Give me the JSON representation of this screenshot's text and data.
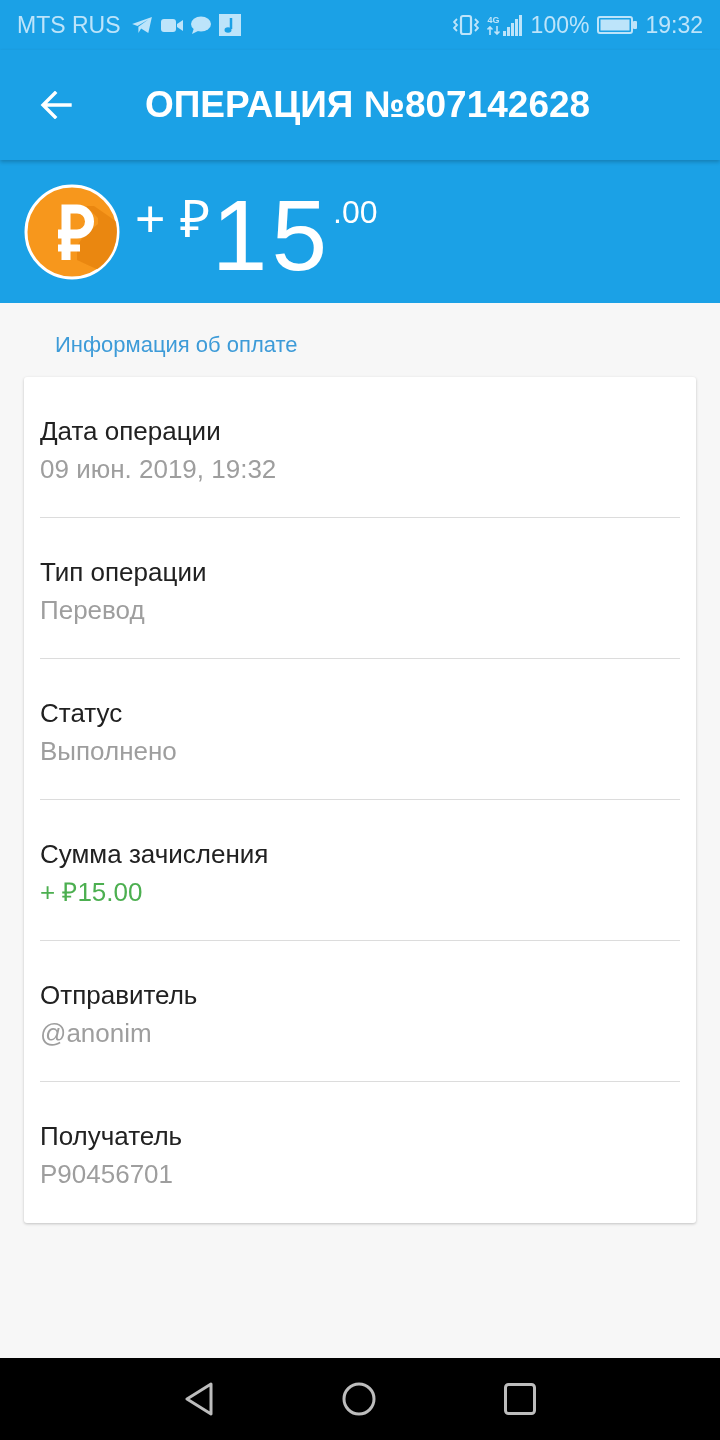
{
  "status_bar": {
    "carrier": "MTS RUS",
    "network_type": "4G",
    "battery": "100%",
    "time": "19:32"
  },
  "toolbar": {
    "title": "ОПЕРАЦИЯ №807142628"
  },
  "amount": {
    "prefix": "+ ₽",
    "integer": "15",
    "fraction": ".00"
  },
  "section": {
    "title": "Информация об оплате"
  },
  "details": [
    {
      "label": "Дата операции",
      "value": "09 июн. 2019, 19:32",
      "kind": "text"
    },
    {
      "label": "Тип операции",
      "value": "Перевод",
      "kind": "text"
    },
    {
      "label": "Статус",
      "value": "Выполнено",
      "kind": "text"
    },
    {
      "label": "Сумма зачисления",
      "value": "+ ₽15.00",
      "kind": "credit"
    },
    {
      "label": "Отправитель",
      "value": "@anonim",
      "kind": "text"
    },
    {
      "label": "Получатель",
      "value": "P90456701",
      "kind": "text"
    }
  ]
}
